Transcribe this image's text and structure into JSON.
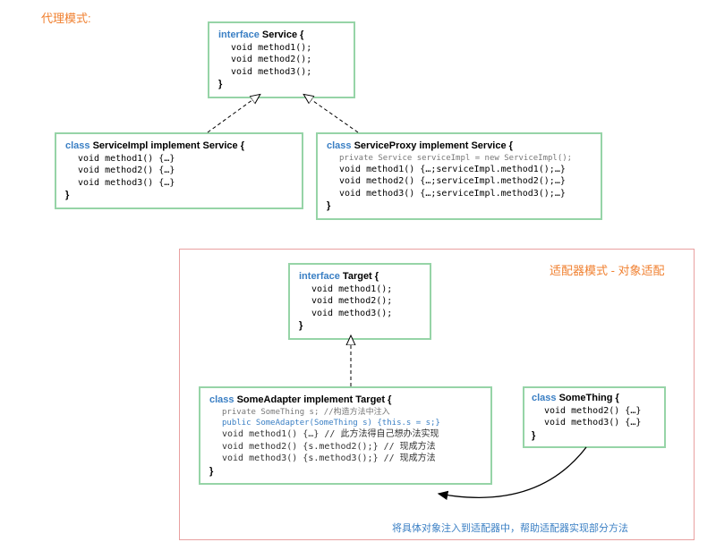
{
  "labels": {
    "proxy_title": "代理模式:",
    "adapter_title": "适配器模式 - 对象适配",
    "adapter_caption": "将具体对象注入到适配器中，帮助适配器实现部分方法"
  },
  "proxy": {
    "service_iface": {
      "kw": "interface",
      "name": "Service",
      "open": "{",
      "m1": "void method1();",
      "m2": "void method2();",
      "m3": "void method3();",
      "close": "}"
    },
    "service_impl": {
      "kw": "class",
      "name": "ServiceImpl",
      "impl_kw": "implement",
      "impl": "Service",
      "open": "{",
      "m1": "void method1() {…}",
      "m2": "void method2() {…}",
      "m3": "void method3() {…}",
      "close": "}"
    },
    "service_proxy": {
      "kw": "class",
      "name": "ServiceProxy",
      "impl_kw": "implement",
      "impl": "Service",
      "open": "{",
      "priv": "private Service serviceImpl = new ServiceImpl();",
      "m1": "void method1() {…;serviceImpl.method1();…}",
      "m2": "void method2() {…;serviceImpl.method2();…}",
      "m3": "void method3() {…;serviceImpl.method3();…}",
      "close": "}"
    }
  },
  "adapter": {
    "target_iface": {
      "kw": "interface",
      "name": "Target",
      "open": "{",
      "m1": "void method1();",
      "m2": "void method2();",
      "m3": "void method3();",
      "close": "}"
    },
    "some_adapter": {
      "kw": "class",
      "name": "SomeAdapter",
      "impl_kw": "implement",
      "impl": "Target",
      "open": "{",
      "priv": "private SomeThing s; //构造方法中注入",
      "ctor": "public SomeAdapter(SomeThing s) {this.s = s;}",
      "m1": "void method1() {…}  // 此方法得自己想办法实现",
      "m2": "void method2() {s.method2();}  // 现成方法",
      "m3": "void method3() {s.method3();}  // 现成方法",
      "close": "}"
    },
    "some_thing": {
      "kw": "class",
      "name": "SomeThing",
      "open": "{",
      "m2": "void method2() {…}",
      "m3": "void method3() {…}",
      "close": "}"
    }
  }
}
